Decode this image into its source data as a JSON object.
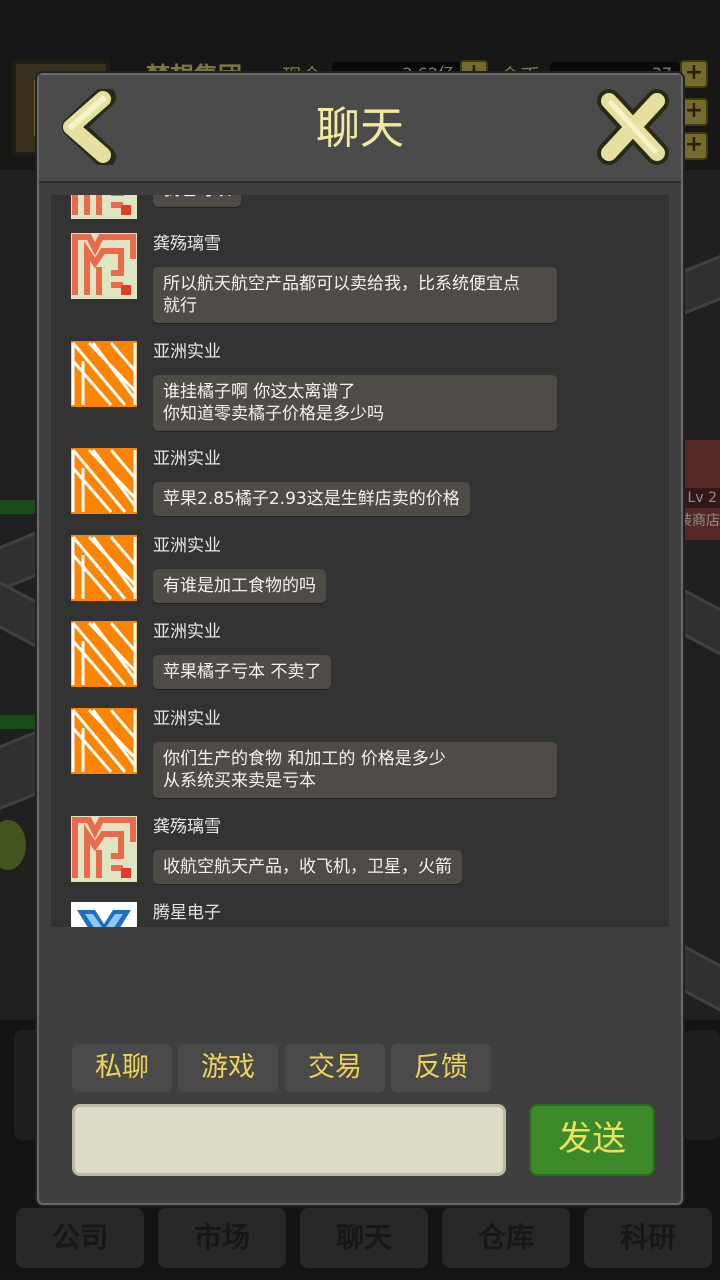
{
  "background": {
    "company_name": "梦想集团",
    "cash_label": "现金",
    "cash_value": "2.62亿",
    "gold_label": "金币",
    "gold_value": "37",
    "level_badge": "Lv 2",
    "shop_label": "装商店",
    "bottom_tabs": [
      "公司",
      "市场",
      "聊天",
      "仓库",
      "科研"
    ]
  },
  "modal": {
    "title": "聊天",
    "back_icon": "back-arrow-icon",
    "close_icon": "close-x-icon"
  },
  "messages": [
    {
      "sender": "",
      "avatar": "maze-avatar",
      "text": "我也可以"
    },
    {
      "sender": "龚殇璃雪",
      "avatar": "maze-avatar",
      "text": "所以航天航空产品都可以卖给我，比系统便宜点\n就行"
    },
    {
      "sender": "亚洲实业",
      "avatar": "stripes-avatar",
      "text": "谁挂橘子啊  你这太离谱了\n你知道零卖橘子价格是多少吗"
    },
    {
      "sender": "亚洲实业",
      "avatar": "stripes-avatar",
      "text": "苹果2.85橘子2.93这是生鲜店卖的价格"
    },
    {
      "sender": "亚洲实业",
      "avatar": "stripes-avatar",
      "text": "有谁是加工食物的吗"
    },
    {
      "sender": "亚洲实业",
      "avatar": "stripes-avatar",
      "text": "苹果橘子亏本 不卖了"
    },
    {
      "sender": "亚洲实业",
      "avatar": "stripes-avatar",
      "text": "你们生产的食物 和加工的 价格是多少\n从系统买来卖是亏本"
    },
    {
      "sender": "龚殇璃雪",
      "avatar": "maze-avatar",
      "text": "收航空航天产品，收飞机，卫星，火箭"
    },
    {
      "sender": "腾星电子",
      "avatar": "chevron-avatar",
      "text": ""
    }
  ],
  "channels": [
    "私聊",
    "游戏",
    "交易",
    "反馈"
  ],
  "input": {
    "placeholder": "",
    "value": ""
  },
  "send_label": "发送",
  "colors": {
    "title": "#f0eba0",
    "channel_text": "#ecd35a",
    "send_bg": "#3c8a2a",
    "stripes_avatar": "#ff8400",
    "maze_avatar": "#e86b4b"
  }
}
